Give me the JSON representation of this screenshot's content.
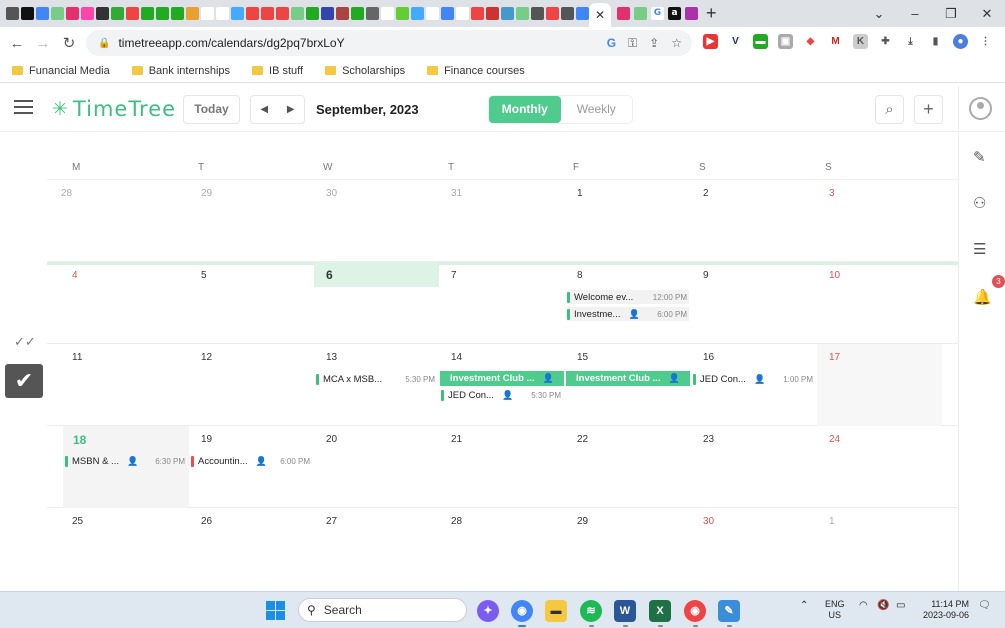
{
  "browser": {
    "tab_icons": [
      {
        "name": "tab-icon-1",
        "color": "#555"
      },
      {
        "name": "tab-icon-2",
        "color": "#111"
      },
      {
        "name": "tab-icon-3",
        "color": "#4285f4"
      },
      {
        "name": "tab-icon-4",
        "color": "#7c8"
      },
      {
        "name": "tab-icon-5",
        "color": "#e1306c"
      },
      {
        "name": "tab-icon-6",
        "color": "#f4a"
      },
      {
        "name": "tab-icon-7",
        "color": "#333"
      },
      {
        "name": "tab-icon-8",
        "color": "#3a3"
      },
      {
        "name": "tab-icon-9",
        "color": "#e44"
      },
      {
        "name": "tab-icon-10",
        "color": "#2a2"
      },
      {
        "name": "tab-icon-11",
        "color": "#2a2"
      },
      {
        "name": "tab-icon-12",
        "color": "#2a2"
      },
      {
        "name": "tab-icon-13",
        "color": "#e9a030"
      },
      {
        "name": "tab-icon-14",
        "color": "#fff"
      },
      {
        "name": "tab-icon-15",
        "color": "#fff"
      },
      {
        "name": "tab-icon-16",
        "color": "#4af"
      },
      {
        "name": "tab-icon-17",
        "color": "#e44"
      },
      {
        "name": "tab-icon-18",
        "color": "#e44"
      },
      {
        "name": "tab-icon-19",
        "color": "#e44"
      },
      {
        "name": "tab-icon-20",
        "color": "#7c8"
      },
      {
        "name": "tab-icon-21",
        "color": "#2a2"
      },
      {
        "name": "tab-icon-22",
        "color": "#34a"
      },
      {
        "name": "tab-icon-23",
        "color": "#a44"
      },
      {
        "name": "tab-icon-24",
        "color": "#2a2"
      },
      {
        "name": "tab-icon-25",
        "color": "#666"
      },
      {
        "name": "tab-icon-26",
        "color": "#fff"
      },
      {
        "name": "tab-icon-27",
        "color": "#6c3"
      },
      {
        "name": "tab-icon-28",
        "color": "#4af"
      },
      {
        "name": "tab-icon-29",
        "color": "#fff"
      },
      {
        "name": "tab-icon-30",
        "color": "#4285f4"
      },
      {
        "name": "tab-icon-31",
        "color": "#fff"
      },
      {
        "name": "tab-icon-32",
        "color": "#e44"
      },
      {
        "name": "tab-icon-33",
        "color": "#c33"
      },
      {
        "name": "tab-icon-34",
        "color": "#49c"
      },
      {
        "name": "tab-icon-35",
        "color": "#7c8"
      },
      {
        "name": "tab-icon-36",
        "color": "#555"
      },
      {
        "name": "tab-icon-37",
        "color": "#e44"
      },
      {
        "name": "tab-icon-38",
        "color": "#555"
      },
      {
        "name": "tab-icon-39",
        "color": "#4285f4"
      }
    ],
    "active_tab_close": "✕",
    "url": "timetreeapp.com/calendars/dg2pq7brxLoY",
    "bookmarks": [
      "Funancial Media",
      "Bank internships",
      "IB stuff",
      "Scholarships",
      "Finance courses"
    ]
  },
  "app": {
    "logo": "TimeTree",
    "today_button": "Today",
    "month_title": "September, 2023",
    "view_tabs": [
      "Monthly",
      "Weekly"
    ],
    "notification_count": "3",
    "weekdays": [
      "M",
      "T",
      "W",
      "T",
      "F",
      "S",
      "S"
    ],
    "weeks": [
      [
        "28",
        "29",
        "30",
        "31",
        "1",
        "2",
        "3"
      ],
      [
        "4",
        "5",
        "6",
        "7",
        "8",
        "9",
        "10"
      ],
      [
        "11",
        "12",
        "13",
        "14",
        "15",
        "16",
        "17"
      ],
      [
        "18",
        "19",
        "20",
        "21",
        "22",
        "23",
        "24"
      ],
      [
        "25",
        "26",
        "27",
        "28",
        "29",
        "30",
        "1"
      ]
    ],
    "events": [
      {
        "title": "Welcome ev...",
        "time": "12:00 PM",
        "people": ""
      },
      {
        "title": "Investme...",
        "time": "6:00 PM",
        "people": "👤"
      },
      {
        "title": "MCA x MSB...",
        "time": "5:30 PM",
        "people": ""
      },
      {
        "title": "Investment Club ...",
        "time": "",
        "people": "👤"
      },
      {
        "title": "Investment Club ...",
        "time": "",
        "people": "👤"
      },
      {
        "title": "JED Con...",
        "time": "5:30 PM",
        "people": "👤"
      },
      {
        "title": "JED Con...",
        "time": "1:00 PM",
        "people": "👤"
      },
      {
        "title": "MSBN & ...",
        "time": "6:30 PM",
        "people": "👤"
      },
      {
        "title": "Accountin...",
        "time": "6:00 PM",
        "people": "👤"
      }
    ],
    "colors": {
      "accent": "#4ecb8d",
      "sunday": "#e05252",
      "today_bg": "#ddf3e6"
    }
  },
  "taskbar": {
    "search_label": "Search",
    "lang": "ENG",
    "region": "US",
    "time": "11:14 PM",
    "date": "2023-09-06"
  }
}
